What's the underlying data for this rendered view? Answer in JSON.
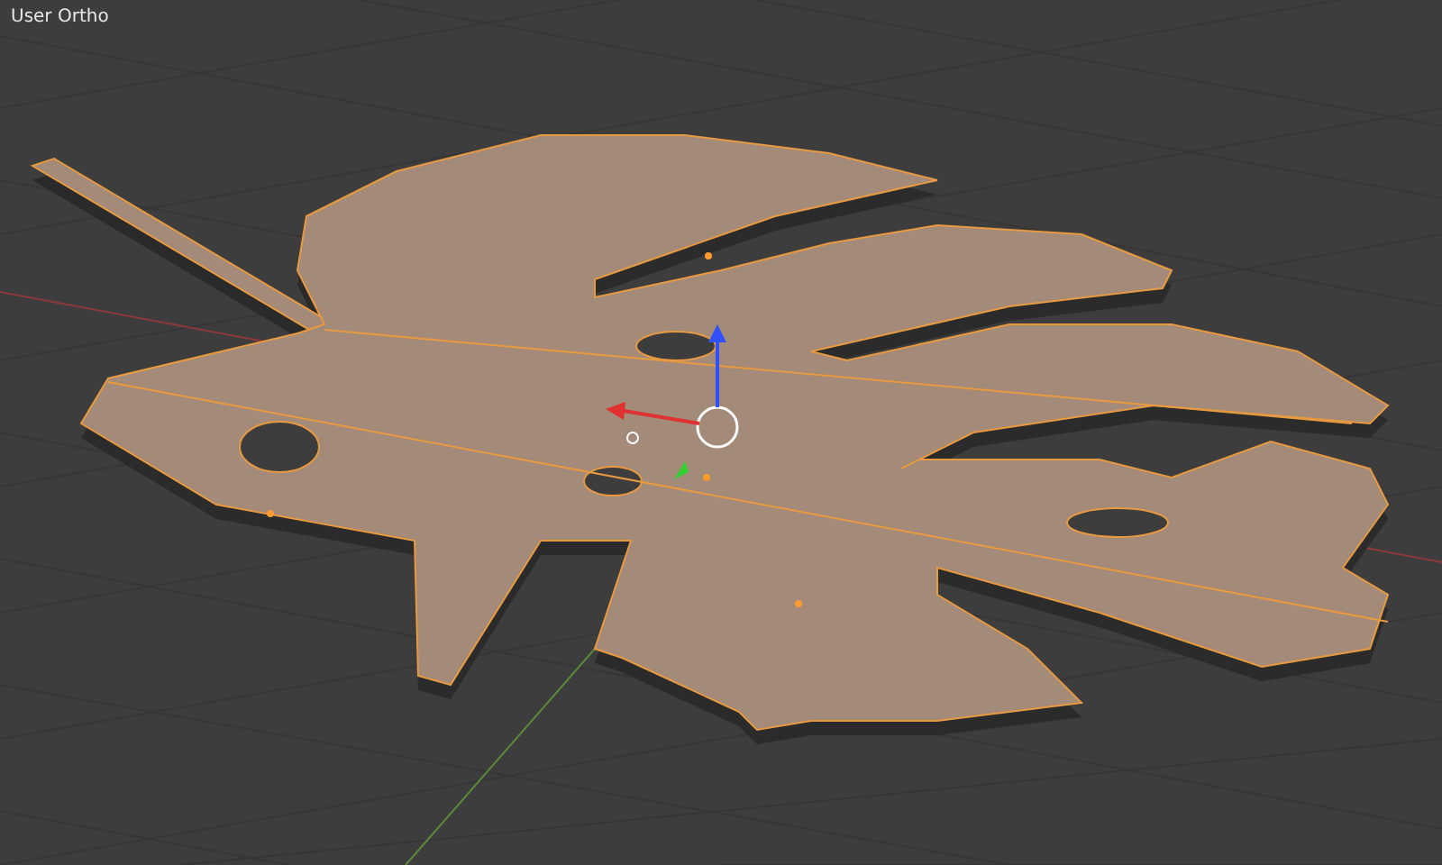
{
  "viewport": {
    "view_label": "User Ortho"
  }
}
